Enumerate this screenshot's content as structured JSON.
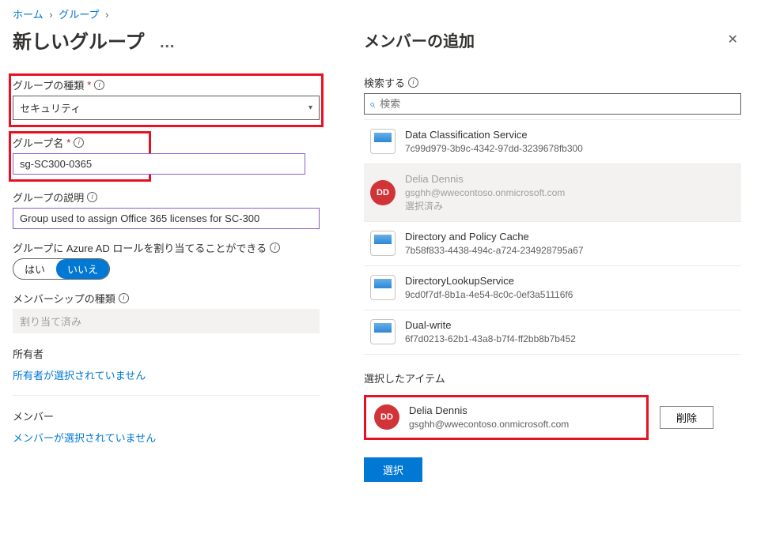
{
  "breadcrumb": {
    "home": "ホーム",
    "groups": "グループ"
  },
  "page": {
    "title": "新しいグループ",
    "more": "…"
  },
  "fields": {
    "group_type_label": "グループの種類",
    "group_type_value": "セキュリティ",
    "group_name_label": "グループ名",
    "group_name_value": "sg-SC300-0365",
    "group_desc_label": "グループの説明",
    "group_desc_value": "Group used to assign Office 365 licenses for SC-300",
    "aad_roles_label": "グループに Azure AD ロールを割り当てることができる",
    "toggle_yes": "はい",
    "toggle_no": "いいえ",
    "membership_type_label": "メンバーシップの種類",
    "membership_type_value": "割り当て済み",
    "owners_label": "所有者",
    "owners_empty": "所有者が選択されていません",
    "members_label": "メンバー",
    "members_empty": "メンバーが選択されていません"
  },
  "panel": {
    "title": "メンバーの追加",
    "search_label": "検索する",
    "search_placeholder": "検索",
    "selected_items_label": "選択したアイテム",
    "remove_button": "削除",
    "select_button": "選択",
    "already_selected_text": "選択済み"
  },
  "results": [
    {
      "kind": "app",
      "name": "Data Classification Service",
      "sub": "7c99d979-3b9c-4342-97dd-3239678fb300"
    },
    {
      "kind": "user",
      "initials": "DD",
      "name": "Delia Dennis",
      "sub": "gsghh@wwecontoso.onmicrosoft.com",
      "selected": true
    },
    {
      "kind": "app",
      "name": "Directory and Policy Cache",
      "sub": "7b58f833-4438-494c-a724-234928795a67"
    },
    {
      "kind": "app",
      "name": "DirectoryLookupService",
      "sub": "9cd0f7df-8b1a-4e54-8c0c-0ef3a51116f6"
    },
    {
      "kind": "app",
      "name": "Dual-write",
      "sub": "6f7d0213-62b1-43a8-b7f4-ff2bb8b7b452"
    }
  ],
  "selected_item": {
    "initials": "DD",
    "name": "Delia Dennis",
    "sub": "gsghh@wwecontoso.onmicrosoft.com"
  }
}
